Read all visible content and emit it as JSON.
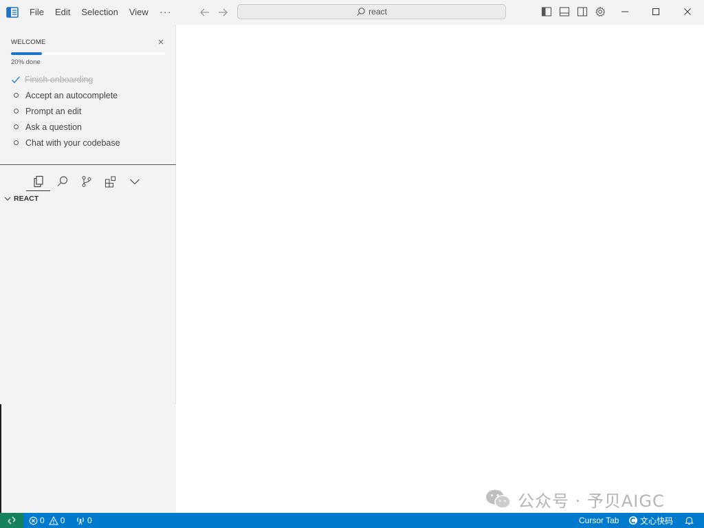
{
  "titlebar": {
    "menu": [
      "File",
      "Edit",
      "Selection",
      "View"
    ],
    "more_label": "···",
    "search_text": "react"
  },
  "welcome": {
    "title": "WELCOME",
    "progress_fraction": 0.2,
    "progress_text": "20% done",
    "items": [
      {
        "label": "Finish onboarding",
        "done": true
      },
      {
        "label": "Accept an autocomplete",
        "done": false
      },
      {
        "label": "Prompt an edit",
        "done": false
      },
      {
        "label": "Ask a question",
        "done": false
      },
      {
        "label": "Chat with your codebase",
        "done": false
      }
    ]
  },
  "explorer": {
    "folder_name": "REACT"
  },
  "statusbar": {
    "errors": "0",
    "warnings": "0",
    "ports": "0",
    "cursor_tab": "Cursor Tab",
    "extension_label": "文心快码"
  },
  "watermark": {
    "text": "公众号 · 予贝AIGC"
  },
  "colors": {
    "accent": "#007acc",
    "progress": "#1f74c8",
    "remote": "#16825d"
  }
}
